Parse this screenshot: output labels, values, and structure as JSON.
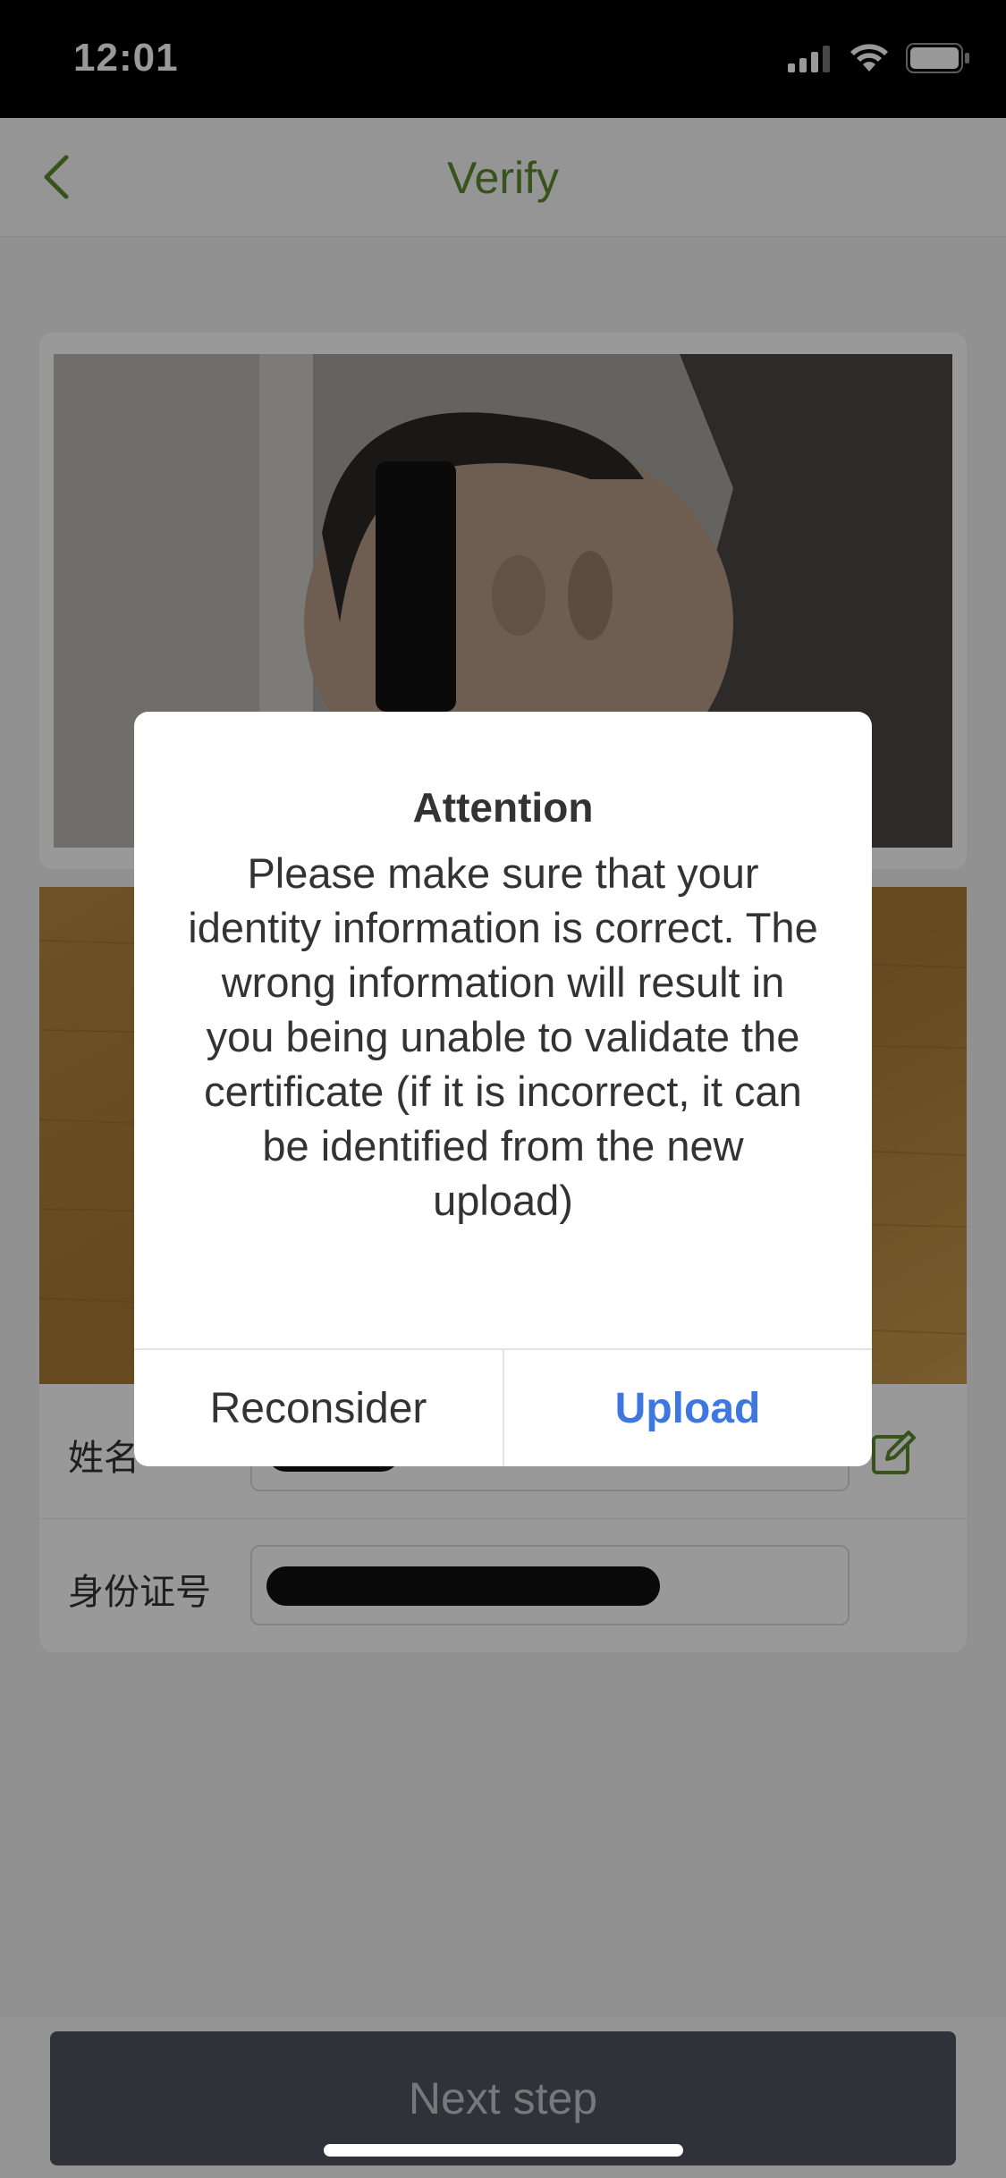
{
  "status_bar": {
    "time": "12:01"
  },
  "nav": {
    "title": "Verify"
  },
  "form": {
    "name_label": "姓名",
    "id_label": "身份证号"
  },
  "bottom": {
    "next_label": "Next step"
  },
  "dialog": {
    "title": "Attention",
    "message": "Please make sure that your identity information is correct. The wrong information will result in you being unable to validate the certificate (if it is incorrect, it can be identified from the new upload)",
    "reconsider_label": "Reconsider",
    "upload_label": "Upload"
  },
  "colors": {
    "accent_green": "#5c8a2e",
    "link_blue": "#3d78e0",
    "button_dark": "#50535f"
  }
}
